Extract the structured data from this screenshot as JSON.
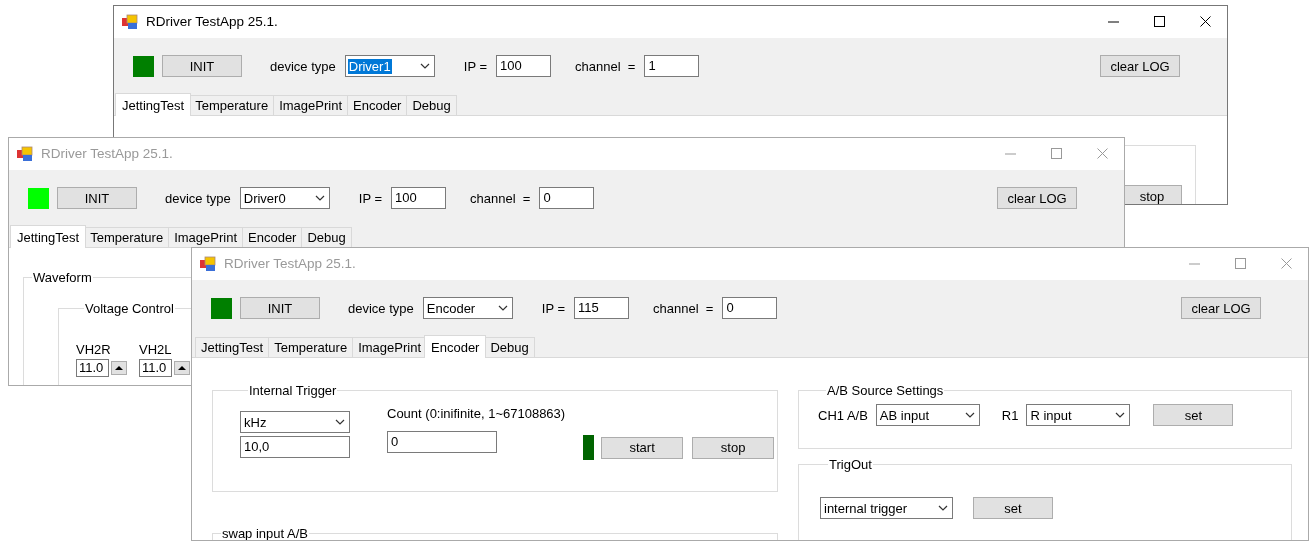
{
  "windows": [
    {
      "title": "RDriver TestApp 25.1.",
      "active": true,
      "indicator": {
        "color": "#007f00"
      },
      "init_button": "INIT",
      "device_type": {
        "label": "device type",
        "value": "Driver1",
        "highlighted": true
      },
      "ip": {
        "label": "IP =",
        "value": "100"
      },
      "channel": {
        "label": "channel  =",
        "value": "1"
      },
      "clear_button": "clear LOG",
      "tabs": [
        {
          "label": "JettingTest",
          "selected": true
        },
        {
          "label": "Temperature",
          "selected": false
        },
        {
          "label": "ImagePrint",
          "selected": false
        },
        {
          "label": "Encoder",
          "selected": false
        },
        {
          "label": "Debug",
          "selected": false
        }
      ],
      "content": {
        "kind": "fragment",
        "buttons": [
          "stop"
        ]
      }
    },
    {
      "title": "RDriver TestApp 25.1.",
      "active": false,
      "indicator": {
        "color": "#00ff00"
      },
      "init_button": "INIT",
      "device_type": {
        "label": "device type",
        "value": "Driver0",
        "highlighted": false
      },
      "ip": {
        "label": "IP =",
        "value": "100"
      },
      "channel": {
        "label": "channel  =",
        "value": "0"
      },
      "clear_button": "clear LOG",
      "tabs": [
        {
          "label": "JettingTest",
          "selected": true
        },
        {
          "label": "Temperature",
          "selected": false
        },
        {
          "label": "ImagePrint",
          "selected": false
        },
        {
          "label": "Encoder",
          "selected": false
        },
        {
          "label": "Debug",
          "selected": false
        }
      ],
      "content": {
        "kind": "jetting",
        "group_title": "Waveform",
        "subgroup_title": "Voltage Control",
        "spinners": [
          {
            "label": "VH2R",
            "value": "11.0"
          },
          {
            "label": "VH2L",
            "value": "11.0"
          }
        ]
      }
    },
    {
      "title": "RDriver TestApp 25.1.",
      "active": false,
      "indicator": {
        "color": "#007f00"
      },
      "init_button": "INIT",
      "device_type": {
        "label": "device type",
        "value": "Encoder",
        "highlighted": false
      },
      "ip": {
        "label": "IP =",
        "value": "115"
      },
      "channel": {
        "label": "channel  =",
        "value": "0"
      },
      "clear_button": "clear LOG",
      "tabs": [
        {
          "label": "JettingTest",
          "selected": false
        },
        {
          "label": "Temperature",
          "selected": false
        },
        {
          "label": "ImagePrint",
          "selected": false
        },
        {
          "label": "Encoder",
          "selected": true
        },
        {
          "label": "Debug",
          "selected": false
        }
      ],
      "content": {
        "kind": "encoder",
        "internal_trigger": {
          "title": "Internal Trigger",
          "unit": "kHz",
          "frequency": "10,0",
          "count_label": "Count (0:inifinite, 1~67108863)",
          "count": "0",
          "indicator": {
            "color": "#006400"
          },
          "start": "start",
          "stop": "stop"
        },
        "swap": {
          "title": "swap input A/B"
        },
        "ab_source": {
          "title": "A/B Source Settings",
          "ch_label": "CH1 A/B",
          "ch_value": "AB input",
          "r_label": "R1",
          "r_value": "R input",
          "set": "set"
        },
        "trig_out": {
          "title": "TrigOut",
          "value": "internal trigger",
          "set": "set"
        }
      }
    }
  ]
}
